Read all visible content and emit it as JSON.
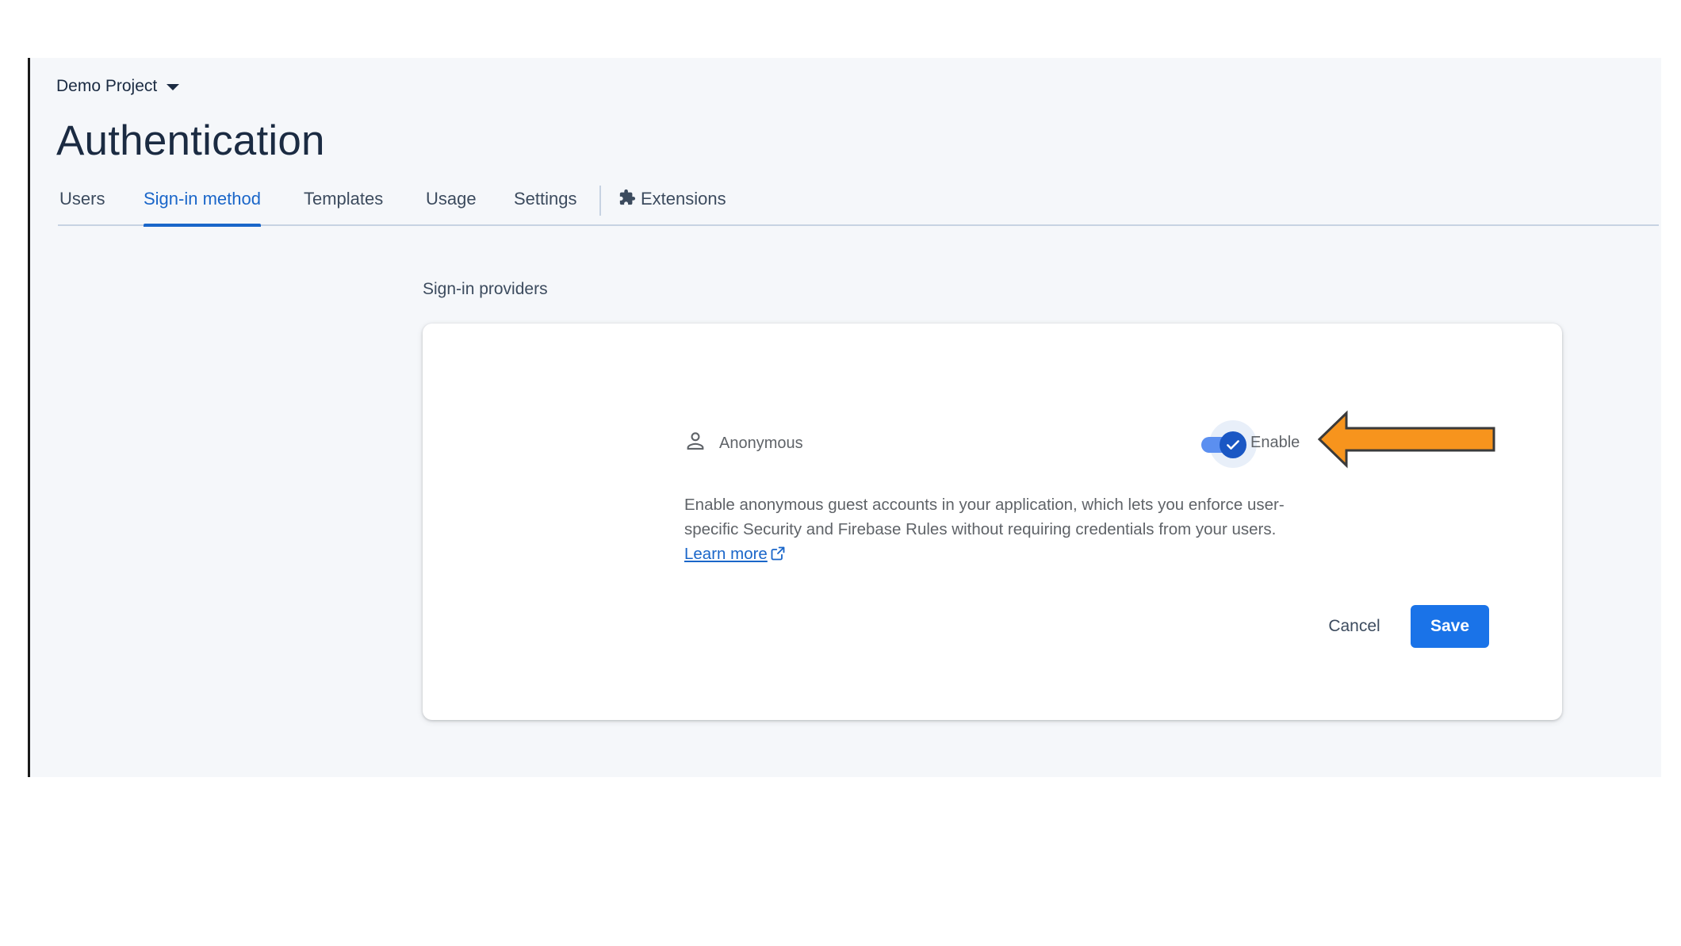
{
  "header": {
    "project_name": "Demo Project",
    "page_title": "Authentication"
  },
  "tabs": [
    {
      "label": "Users"
    },
    {
      "label": "Sign-in method",
      "active": true
    },
    {
      "label": "Templates"
    },
    {
      "label": "Usage"
    },
    {
      "label": "Settings"
    },
    {
      "label": "Extensions",
      "icon": "puzzle-piece-icon"
    }
  ],
  "section": {
    "label": "Sign-in providers"
  },
  "provider": {
    "icon": "person-icon",
    "name": "Anonymous",
    "toggle_label": "Enable",
    "enabled": true,
    "description": "Enable anonymous guest accounts in your application, which lets you enforce user-specific Security and Firebase Rules without requiring credentials from your users.",
    "learn_more": "Learn more"
  },
  "actions": {
    "cancel_label": "Cancel",
    "save_label": "Save"
  },
  "annotation": {
    "icon": "arrow-left-icon",
    "color": "#f7941d"
  },
  "colors": {
    "primary": "#1a73e8",
    "active_tab": "#1a66c9",
    "background": "#f5f7fa"
  }
}
